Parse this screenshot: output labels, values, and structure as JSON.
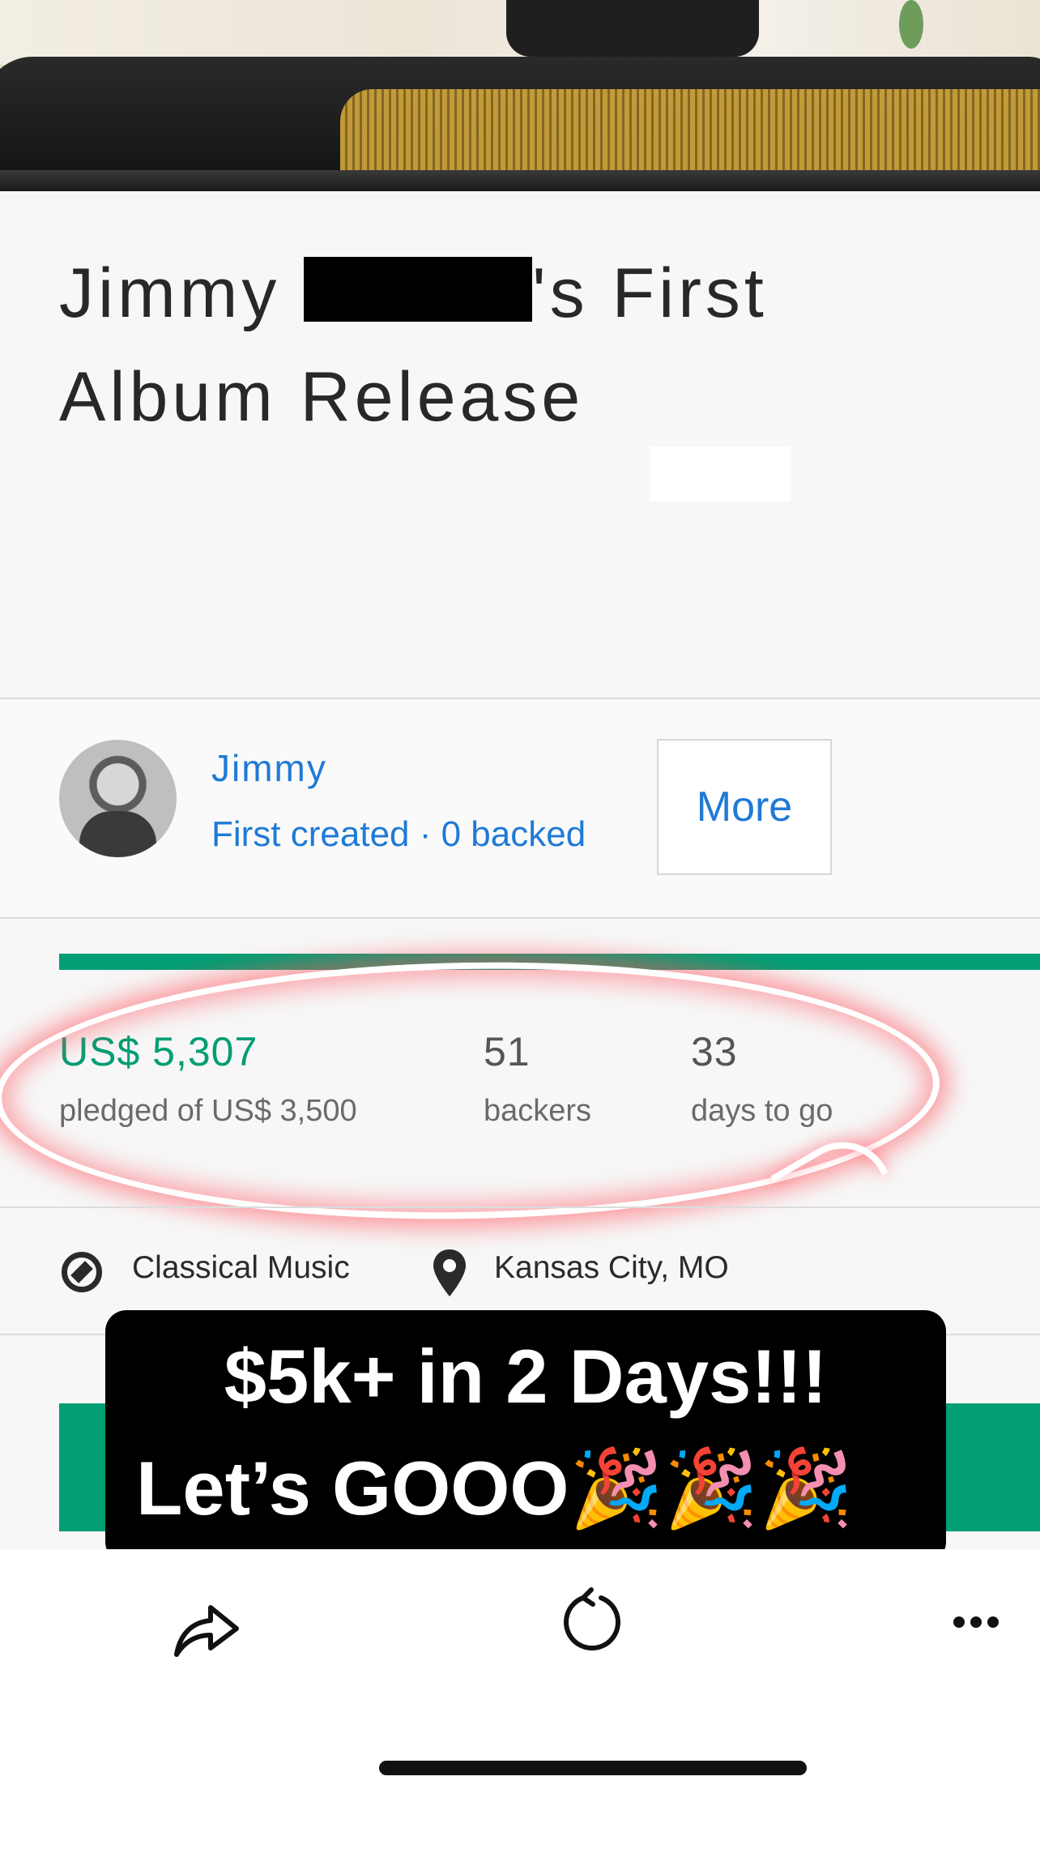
{
  "project": {
    "title_part1": "Jimmy",
    "title_part2": "'s First",
    "title_line2": "Album Release"
  },
  "creator": {
    "name": "Jimmy",
    "subtitle": "First created · 0 backed",
    "more_label": "More"
  },
  "funding": {
    "progress_fraction": 1.0,
    "pledged": "US$ 5,307",
    "pledged_label": "pledged of US$ 3,500",
    "backers": "51",
    "backers_label": "backers",
    "days": "33",
    "days_label": "days to go"
  },
  "meta": {
    "category": "Classical Music",
    "location": "Kansas City, MO"
  },
  "caption": {
    "line1": "$5k+ in 2 Days!!!",
    "line2": "Let’s GOOO🎉🎉🎉"
  },
  "colors": {
    "accent_green": "#029e74",
    "link_blue": "#1f7ad6"
  },
  "icons": {
    "share": "share-icon",
    "reload": "reload-icon",
    "more": "more-icon",
    "compass": "compass-icon",
    "pin": "map-pin-icon"
  }
}
